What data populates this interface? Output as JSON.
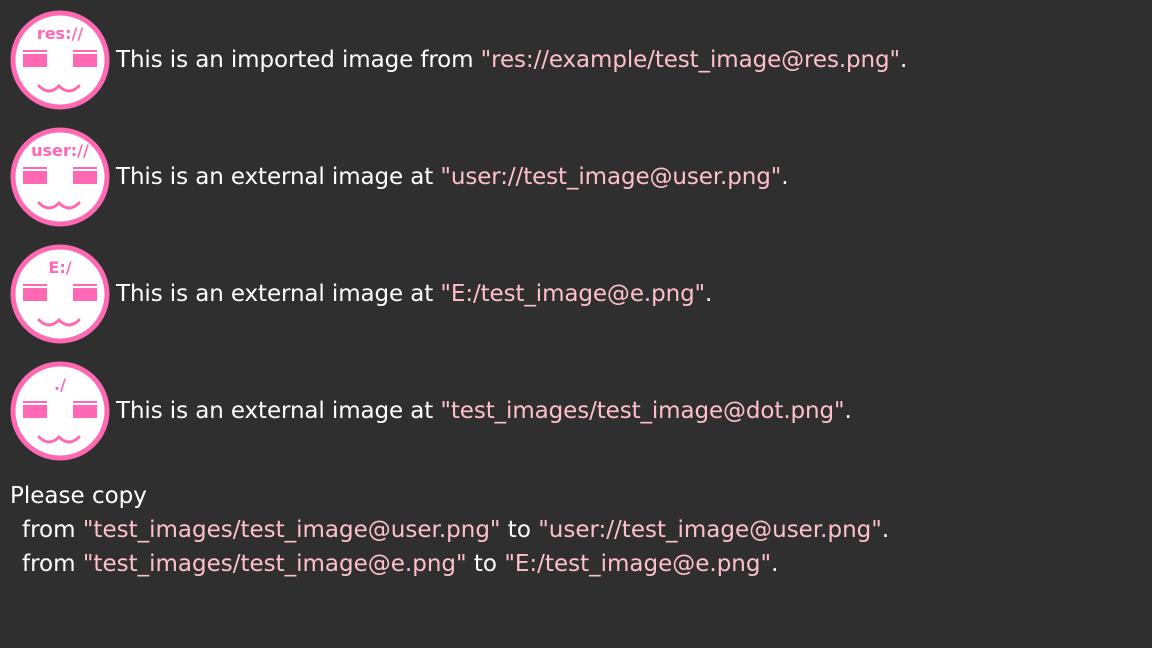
{
  "colors": {
    "background": "#2f2f2f",
    "text": "#ffffff",
    "path": "#ffc0cb",
    "icon_pink": "#ff69b4",
    "icon_bg": "#ffffff"
  },
  "images": [
    {
      "icon": "face-icon",
      "icon_label": "res://",
      "prefix": "This is an imported image from ",
      "path": "\"res://example/test_image@res.png\"",
      "suffix": "."
    },
    {
      "icon": "face-icon",
      "icon_label": "user://",
      "prefix": "This is an external image at ",
      "path": "\"user://test_image@user.png\"",
      "suffix": "."
    },
    {
      "icon": "face-icon",
      "icon_label": "E:/",
      "prefix": "This is an external image at ",
      "path": "\"E:/test_image@e.png\"",
      "suffix": "."
    },
    {
      "icon": "face-icon",
      "icon_label": "./",
      "prefix": "This is an external image at ",
      "path": "\"test_images/test_image@dot.png\"",
      "suffix": "."
    }
  ],
  "instructions": {
    "heading": "Please copy",
    "copies": [
      {
        "from_word": "from ",
        "from_path": "\"test_images/test_image@user.png\"",
        "to_word": " to ",
        "to_path": "\"user://test_image@user.png\"",
        "suffix": "."
      },
      {
        "from_word": "from ",
        "from_path": "\"test_images/test_image@e.png\"",
        "to_word": " to ",
        "to_path": "\"E:/test_image@e.png\"",
        "suffix": "."
      }
    ]
  }
}
